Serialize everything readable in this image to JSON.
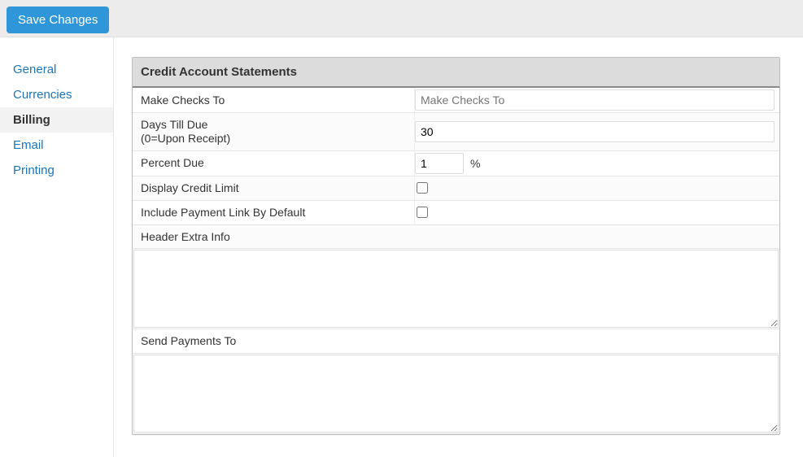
{
  "toolbar": {
    "save_label": "Save Changes"
  },
  "sidebar": {
    "items": [
      {
        "label": "General",
        "active": false
      },
      {
        "label": "Currencies",
        "active": false
      },
      {
        "label": "Billing",
        "active": true
      },
      {
        "label": "Email",
        "active": false
      },
      {
        "label": "Printing",
        "active": false
      }
    ]
  },
  "panel": {
    "title": "Credit Account Statements",
    "make_checks_to": {
      "label": "Make Checks To",
      "value": "",
      "placeholder": "Make Checks To"
    },
    "days_till_due": {
      "label": "Days Till Due",
      "sub": "(0=Upon Receipt)",
      "value": "30"
    },
    "percent_due": {
      "label": "Percent Due",
      "value": "1",
      "suffix": "%"
    },
    "display_credit_limit": {
      "label": "Display Credit Limit",
      "checked": false
    },
    "include_payment_link": {
      "label": "Include Payment Link By Default",
      "checked": false
    },
    "header_extra_info": {
      "label": "Header Extra Info",
      "value": ""
    },
    "send_payments_to": {
      "label": "Send Payments To",
      "value": ""
    }
  }
}
